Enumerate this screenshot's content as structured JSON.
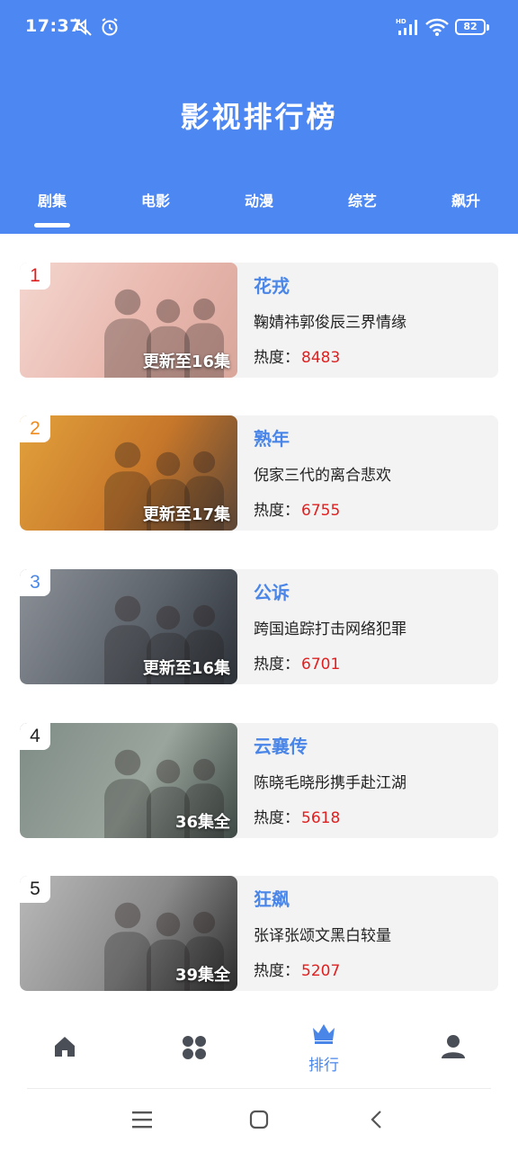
{
  "status_bar": {
    "time": "17:37",
    "battery": "82",
    "icons": [
      "mute-icon",
      "alarm-icon",
      "hd-signal-icon",
      "wifi-icon",
      "battery-icon"
    ]
  },
  "header": {
    "title": "影视排行榜",
    "background_color": "#4d87f2"
  },
  "tabs": [
    {
      "label": "剧集",
      "active": true
    },
    {
      "label": "电影",
      "active": false
    },
    {
      "label": "动漫",
      "active": false
    },
    {
      "label": "综艺",
      "active": false
    },
    {
      "label": "飙升",
      "active": false
    }
  ],
  "items": [
    {
      "rank": "1",
      "rank_color": "#e02020",
      "title": "花戎",
      "desc": "鞠婧祎郭俊辰三界情缘",
      "heat_label": "热度：",
      "heat": "8483",
      "episodes": "更新至16集",
      "poster_text": "花戎",
      "poster_colors": [
        "#f3d6cf",
        "#e9b8ae",
        "#d9a69b"
      ]
    },
    {
      "rank": "2",
      "rank_color": "#f08a1c",
      "title": "熟年",
      "desc": "倪家三代的离合悲欢",
      "heat_label": "热度：",
      "heat": "6755",
      "episodes": "更新至17集",
      "poster_text": "熟年",
      "poster_colors": [
        "#e2a13c",
        "#c7772a",
        "#5b4536"
      ]
    },
    {
      "rank": "3",
      "rank_color": "#4a86e8",
      "title": "公诉",
      "desc": "跨国追踪打击网络犯罪",
      "heat_label": "热度：",
      "heat": "6701",
      "episodes": "更新至16集",
      "poster_text": "公诉",
      "poster_colors": [
        "#8c9198",
        "#5d636b",
        "#2c3138"
      ]
    },
    {
      "rank": "4",
      "rank_color": "#222222",
      "title": "云襄传",
      "desc": "陈晓毛晓彤携手赴江湖",
      "heat_label": "热度：",
      "heat": "5618",
      "episodes": "36集全",
      "poster_text": "云襄传",
      "poster_colors": [
        "#7f8c86",
        "#9aa59d",
        "#3e4844"
      ]
    },
    {
      "rank": "5",
      "rank_color": "#222222",
      "title": "狂飙",
      "desc": "张译张颂文黑白较量",
      "heat_label": "热度：",
      "heat": "5207",
      "episodes": "39集全",
      "poster_text": "狂飙",
      "poster_colors": [
        "#b9b9b9",
        "#8a8a8a",
        "#2b2b2b"
      ]
    }
  ],
  "bottom_nav": [
    {
      "icon": "home-icon",
      "label": "",
      "active": false
    },
    {
      "icon": "category-icon",
      "label": "",
      "active": false
    },
    {
      "icon": "crown-icon",
      "label": "排行",
      "active": true
    },
    {
      "icon": "user-icon",
      "label": "",
      "active": false
    }
  ],
  "colors": {
    "accent": "#4a86e8",
    "heat": "#e02020",
    "card_bg": "#f3f3f3",
    "nav_inactive": "#4a4f57"
  },
  "system_nav": [
    "menu-icon",
    "home-square-icon",
    "back-icon"
  ]
}
